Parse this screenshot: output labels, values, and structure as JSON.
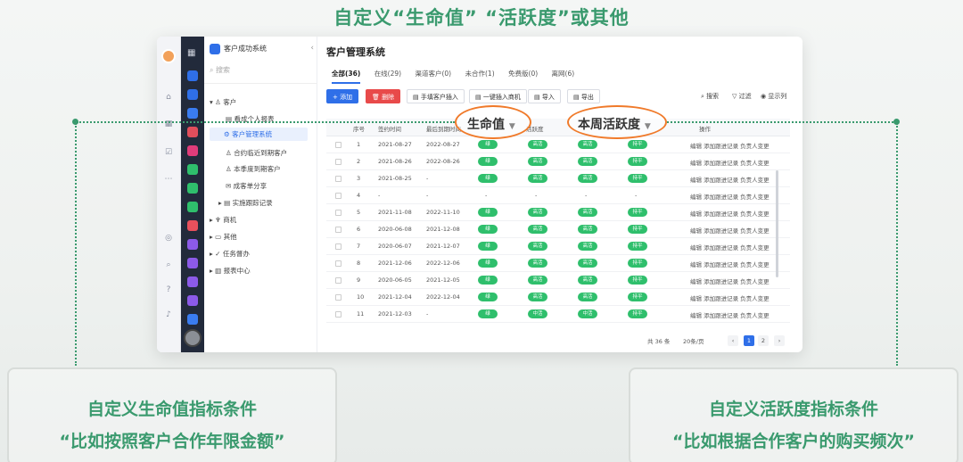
{
  "headline": "自定义“生命值” “活跃度”或其他",
  "app": {
    "nav": {
      "system_title": "客户成功系统",
      "search_placeholder": "搜索",
      "items": [
        {
          "label": "客户",
          "icon": "user-icon"
        },
        {
          "label": "看成个人报表",
          "icon": "report-icon"
        },
        {
          "label": "客户管理系统",
          "icon": "settings-icon"
        },
        {
          "label": "合约临近到期客户",
          "icon": "user-icon"
        },
        {
          "label": "本季度到期客户",
          "icon": "user-icon"
        },
        {
          "label": "成客单分享",
          "icon": "share-icon"
        },
        {
          "label": "实施跟踪记录",
          "icon": "list-icon"
        },
        {
          "label": "商机",
          "icon": "trophy-icon"
        },
        {
          "label": "其他",
          "icon": "folder-icon"
        },
        {
          "label": "任务督办",
          "icon": "task-icon"
        },
        {
          "label": "报表中心",
          "icon": "chart-icon"
        }
      ]
    },
    "page_title": "客户管理系统",
    "tabs": [
      "全部(36)",
      "在线(29)",
      "渠道客户(0)",
      "未合作(1)",
      "免费版(0)",
      "离网(6)"
    ],
    "toolbar": {
      "add": "+ 添加",
      "delete": "删除",
      "manual_insert": "手填客户插入",
      "bulk_insert": "一键插入商机",
      "import": "导入",
      "export": "导出",
      "search": "搜索",
      "filter": "过滤",
      "columns": "显示列"
    },
    "columns": [
      "序号",
      "签约时间",
      "最后到期时间",
      "生命值",
      "活跃度",
      "本周活跃度",
      "操作"
    ],
    "rows": [
      {
        "no": "1",
        "sign": "2021-08-27",
        "expire": "2022-08-27",
        "life": "绿",
        "active": "高活",
        "week": "高活",
        "trend": "持平"
      },
      {
        "no": "2",
        "sign": "2021-08-26",
        "expire": "2022-08-26",
        "life": "绿",
        "active": "高活",
        "week": "高活",
        "trend": "持平"
      },
      {
        "no": "3",
        "sign": "2021-08-25",
        "expire": "-",
        "life": "绿",
        "active": "高活",
        "week": "高活",
        "trend": "持平"
      },
      {
        "no": "4",
        "sign": "-",
        "expire": "-",
        "life": "-",
        "active": "-",
        "week": "-",
        "trend": "-"
      },
      {
        "no": "5",
        "sign": "2021-11-08",
        "expire": "2022-11-10",
        "life": "绿",
        "active": "高活",
        "week": "高活",
        "trend": "持平"
      },
      {
        "no": "6",
        "sign": "2020-06-08",
        "expire": "2021-12-08",
        "life": "绿",
        "active": "高活",
        "week": "高活",
        "trend": "持平"
      },
      {
        "no": "7",
        "sign": "2020-06-07",
        "expire": "2021-12-07",
        "life": "绿",
        "active": "高活",
        "week": "高活",
        "trend": "持平"
      },
      {
        "no": "8",
        "sign": "2021-12-06",
        "expire": "2022-12-06",
        "life": "绿",
        "active": "高活",
        "week": "高活",
        "trend": "持平"
      },
      {
        "no": "9",
        "sign": "2020-06-05",
        "expire": "2021-12-05",
        "life": "绿",
        "active": "高活",
        "week": "高活",
        "trend": "持平"
      },
      {
        "no": "10",
        "sign": "2021-12-04",
        "expire": "2022-12-04",
        "life": "绿",
        "active": "高活",
        "week": "高活",
        "trend": "持平"
      },
      {
        "no": "11",
        "sign": "2021-12-03",
        "expire": "-",
        "life": "绿",
        "active": "中活",
        "week": "中活",
        "trend": "持平"
      }
    ],
    "row_ops": [
      "编辑",
      "添加跟进记录",
      "负责人变更"
    ],
    "pager": {
      "total": "共 36 条",
      "per_page": "20条/页",
      "pages": [
        "1",
        "2"
      ],
      "prev": "‹",
      "next": "›"
    }
  },
  "callouts": {
    "life_label": "生命值",
    "week_label": "本周活跃度",
    "left_title": "自定义生命值指标条件",
    "left_sub": "“比如按照客户合作年限金额”",
    "right_title": "自定义活跃度指标条件",
    "right_sub": "“比如根据合作客户的购买频次”"
  },
  "colors": {
    "accent_green": "#3a9a6e",
    "oval_orange": "#f07a2a",
    "tag_green": "#2fbf6c",
    "primary_blue": "#2f6fe8"
  }
}
